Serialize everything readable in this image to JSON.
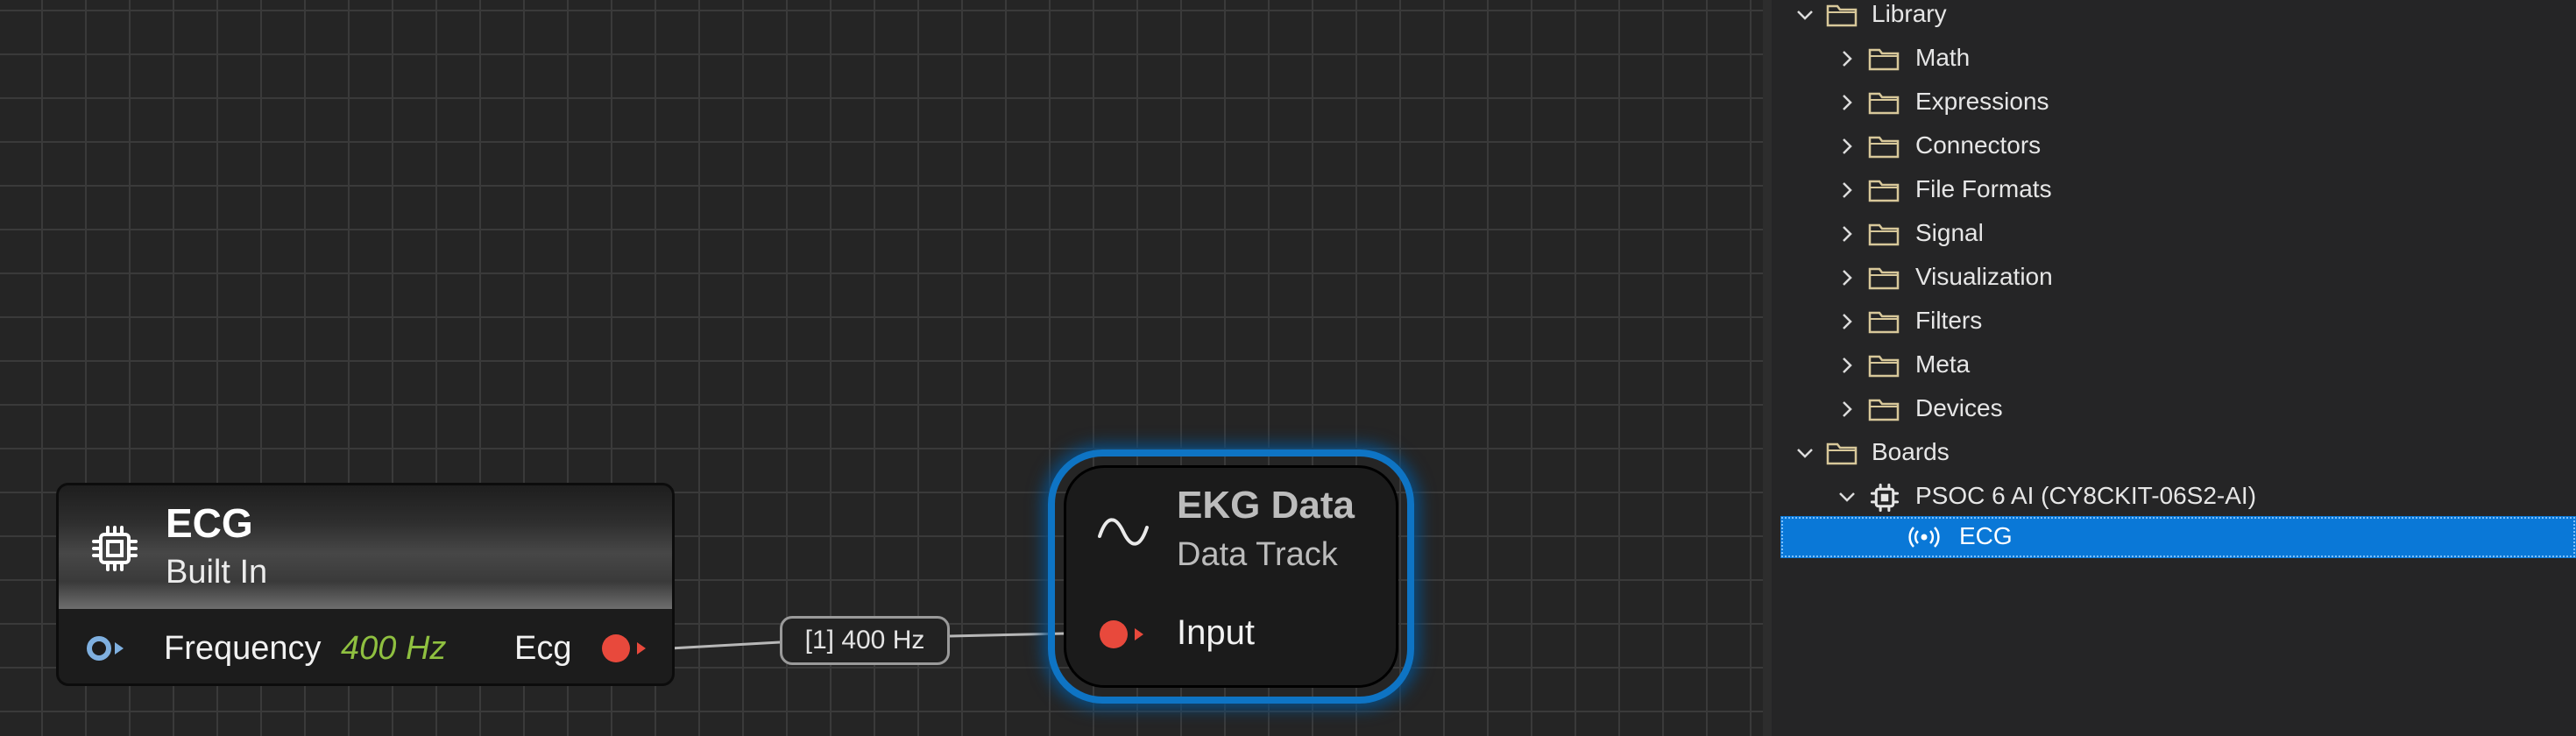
{
  "graph": {
    "ecg_node": {
      "title": "ECG",
      "subtitle": "Built In",
      "input_port_label": "Frequency",
      "input_port_value": "400 Hz",
      "output_port_label": "Ecg",
      "icon": "chip-icon"
    },
    "ekg_node": {
      "title": "EKG Data",
      "subtitle": "Data Track",
      "input_port_label": "Input",
      "icon": "sine-wave-icon"
    },
    "wire": {
      "label": "[1] 400 Hz"
    }
  },
  "tree": {
    "library": {
      "label": "Library",
      "expanded": true,
      "children": [
        {
          "label": "Math"
        },
        {
          "label": "Expressions"
        },
        {
          "label": "Connectors"
        },
        {
          "label": "File Formats"
        },
        {
          "label": "Signal"
        },
        {
          "label": "Visualization"
        },
        {
          "label": "Filters"
        },
        {
          "label": "Meta"
        },
        {
          "label": "Devices"
        }
      ]
    },
    "boards": {
      "label": "Boards",
      "expanded": true,
      "board": {
        "label": "PSOC 6 AI (CY8CKIT-06S2-AI)",
        "expanded": true,
        "device": {
          "label": "ECG",
          "selected": true
        }
      }
    }
  },
  "colors": {
    "selection": "#0a78d7",
    "node_glow": "#0e74c4",
    "output_port": "#e8493c",
    "input_port": "#7fb0e0",
    "value_text": "#8fc040",
    "folder_stroke": "#d8c89a"
  }
}
